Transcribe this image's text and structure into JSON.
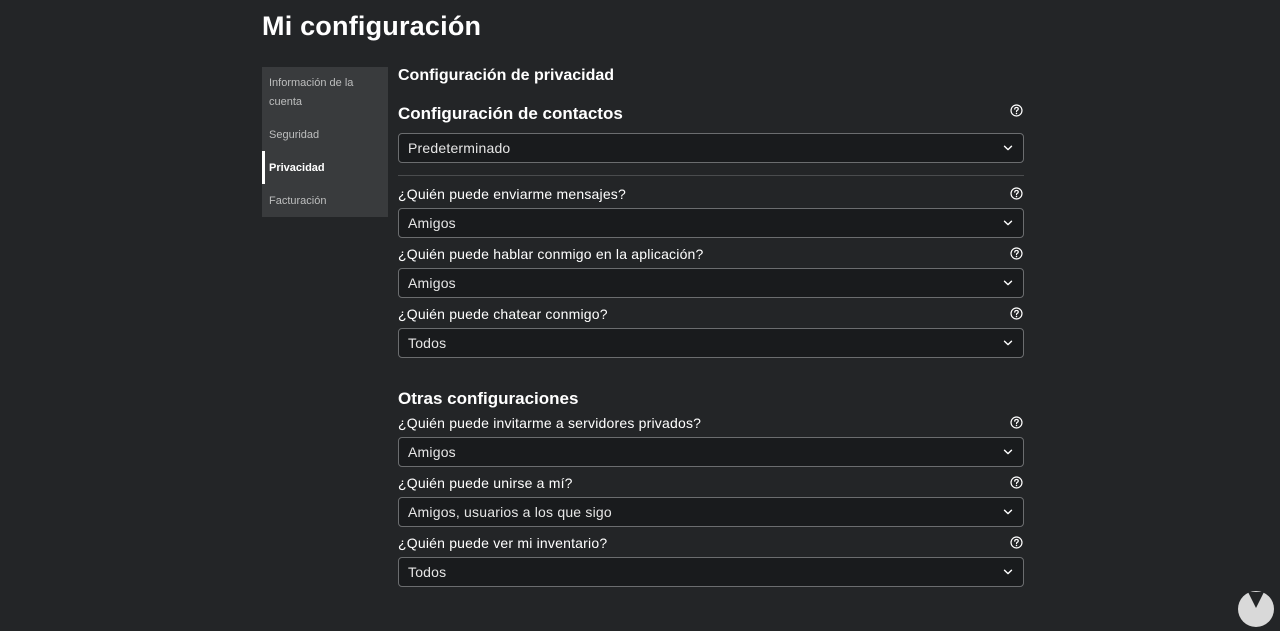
{
  "page": {
    "title": "Mi configuración"
  },
  "sidebar": {
    "items": [
      {
        "label": "Información de la cuenta",
        "active": false
      },
      {
        "label": "Seguridad",
        "active": false
      },
      {
        "label": "Privacidad",
        "active": true
      },
      {
        "label": "Facturación",
        "active": false
      }
    ]
  },
  "privacy": {
    "section_title": "Configuración de privacidad",
    "contact": {
      "title": "Configuración de contactos",
      "value": "Predeterminado"
    },
    "fields": [
      {
        "label": "¿Quién puede enviarme mensajes?",
        "value": "Amigos"
      },
      {
        "label": "¿Quién puede hablar conmigo en la aplicación?",
        "value": "Amigos"
      },
      {
        "label": "¿Quién puede chatear conmigo?",
        "value": "Todos"
      }
    ],
    "other": {
      "title": "Otras configuraciones",
      "fields": [
        {
          "label": "¿Quién puede invitarme a servidores privados?",
          "value": "Amigos"
        },
        {
          "label": "¿Quién puede unirse a mí?",
          "value": "Amigos, usuarios a los que sigo"
        },
        {
          "label": "¿Quién puede ver mi inventario?",
          "value": "Todos"
        }
      ]
    }
  },
  "icons": {
    "help": "help-circle-icon",
    "dropdown": "chevron-down-icon",
    "watermark": "watermark-logo-icon"
  },
  "colors": {
    "background": "#232527",
    "sidebar": "#393b3d",
    "select_bg": "#191b1d",
    "select_border": "#6b6d6f",
    "text": "#ffffff",
    "muted_text": "#bdbebe"
  }
}
